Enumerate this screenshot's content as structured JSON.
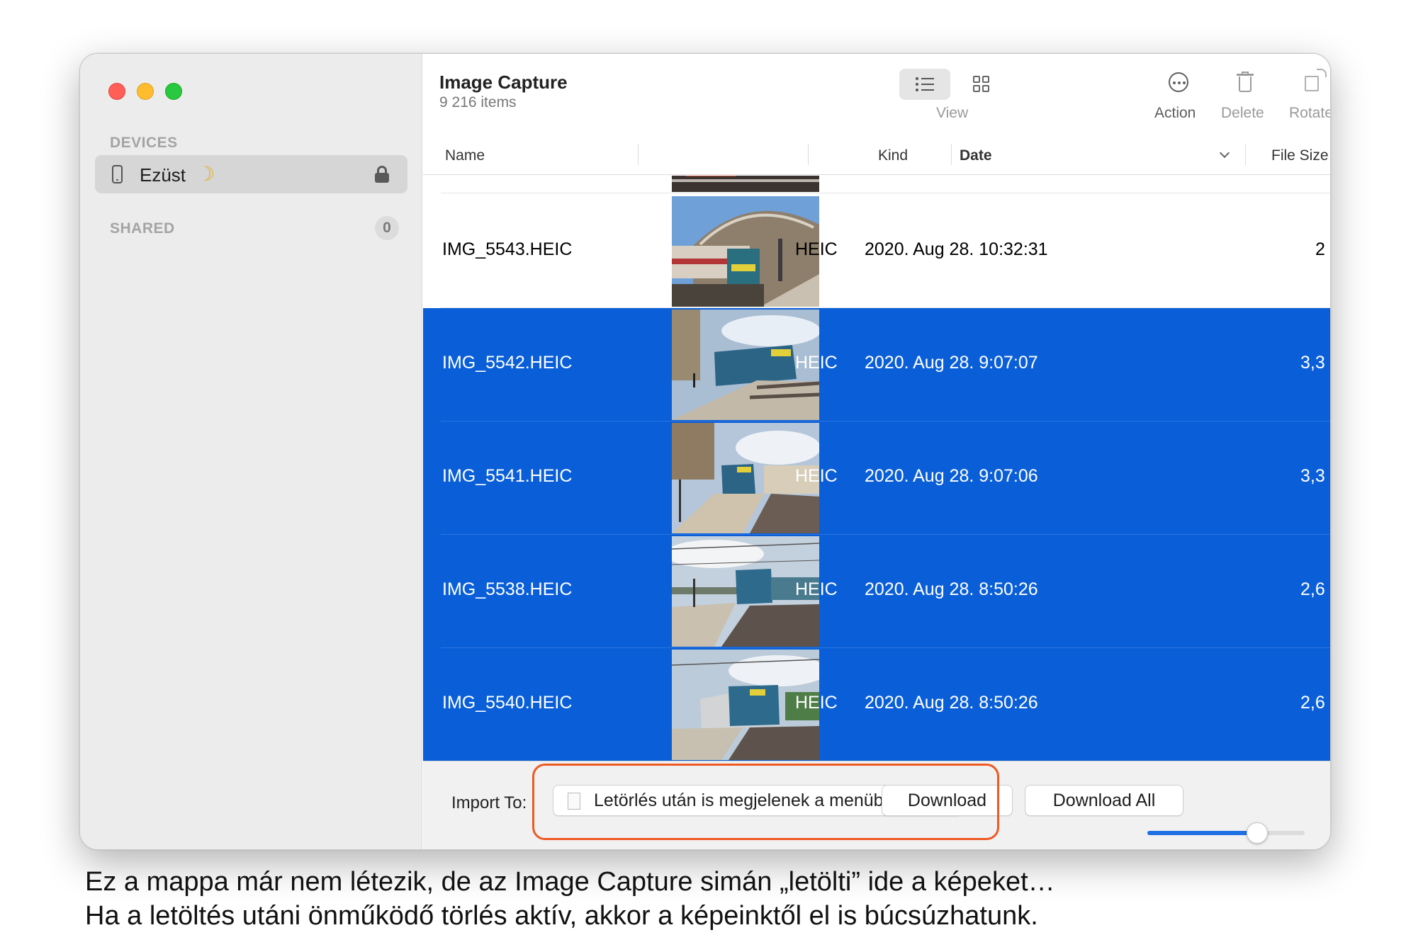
{
  "window": {
    "sidebar": {
      "devices_label": "DEVICES",
      "device_name": "Ezüst",
      "device_emoji": "☽",
      "shared_label": "SHARED",
      "shared_count": "0"
    },
    "toolbar": {
      "title": "Image Capture",
      "subtitle": "9 216 items",
      "view_label": "View",
      "action_label": "Action",
      "delete_label": "Delete",
      "rotate_label": "Rotate"
    },
    "columns": {
      "name": "Name",
      "kind": "Kind",
      "date": "Date",
      "file_size": "File Size"
    },
    "rows": [
      {
        "name": "IMG_5543.HEIC",
        "kind": "HEIC",
        "date": "2020. Aug 28. 10:32:31",
        "size": "2",
        "selected": false
      },
      {
        "name": "IMG_5542.HEIC",
        "kind": "HEIC",
        "date": "2020. Aug 28. 9:07:07",
        "size": "3,3",
        "selected": true
      },
      {
        "name": "IMG_5541.HEIC",
        "kind": "HEIC",
        "date": "2020. Aug 28. 9:07:06",
        "size": "3,3",
        "selected": true
      },
      {
        "name": "IMG_5538.HEIC",
        "kind": "HEIC",
        "date": "2020. Aug 28. 8:50:26",
        "size": "2,6",
        "selected": true
      },
      {
        "name": "IMG_5540.HEIC",
        "kind": "HEIC",
        "date": "2020. Aug 28. 8:50:26",
        "size": "2,6",
        "selected": true
      }
    ],
    "footer": {
      "import_label": "Import To:",
      "import_destination": "Letörlés után is megjelenek a menüben",
      "download_label": "Download",
      "download_all_label": "Download All",
      "thumbnail_size_fraction": 0.7
    }
  },
  "caption": {
    "line1": "Ez a mappa már nem létezik, de az Image Capture simán „letölti” ide a képeket…",
    "line2": "Ha a letöltés utáni önműködő törlés aktív, akkor a képeinktől el is búcsúzhatunk."
  },
  "colors": {
    "selection": "#0a5fd8",
    "highlight": "#ee5a24",
    "accent": "#1f6fe5"
  }
}
